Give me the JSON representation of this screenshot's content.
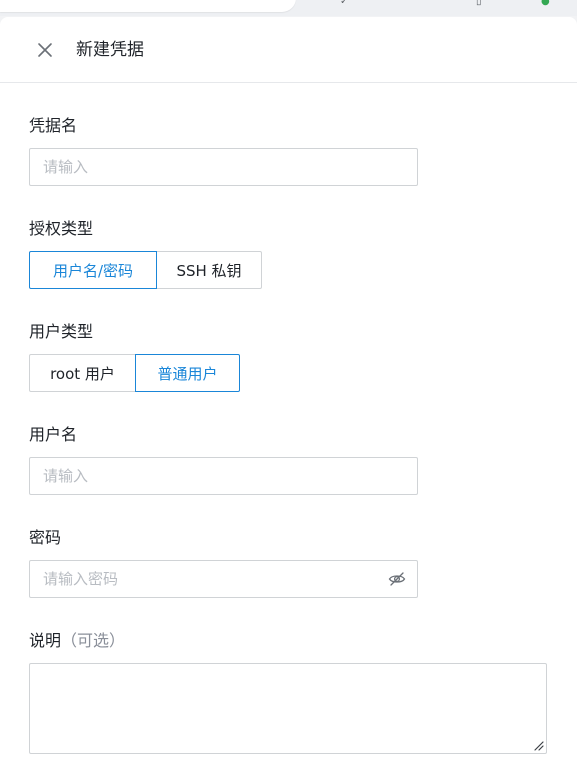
{
  "drawer": {
    "title": "新建凭据"
  },
  "form": {
    "credential_name": {
      "label": "凭据名",
      "placeholder": "请输入"
    },
    "auth_type": {
      "label": "授权类型",
      "options": [
        "用户名/密码",
        "SSH 私钥"
      ],
      "selected": "用户名/密码"
    },
    "user_type": {
      "label": "用户类型",
      "options": [
        "root 用户",
        "普通用户"
      ],
      "selected": "普通用户"
    },
    "username": {
      "label": "用户名",
      "placeholder": "请输入"
    },
    "password": {
      "label": "密码",
      "placeholder": "请输入密码"
    },
    "description": {
      "label": "说明",
      "optional": "（可选）"
    }
  },
  "icons": {
    "close": "close-icon",
    "password_toggle": "eye-off-icon",
    "resize": "resize-grip-icon"
  },
  "colors": {
    "accent": "#1a86d8",
    "border": "#d0d3d6",
    "placeholder": "#b8bcc2"
  }
}
